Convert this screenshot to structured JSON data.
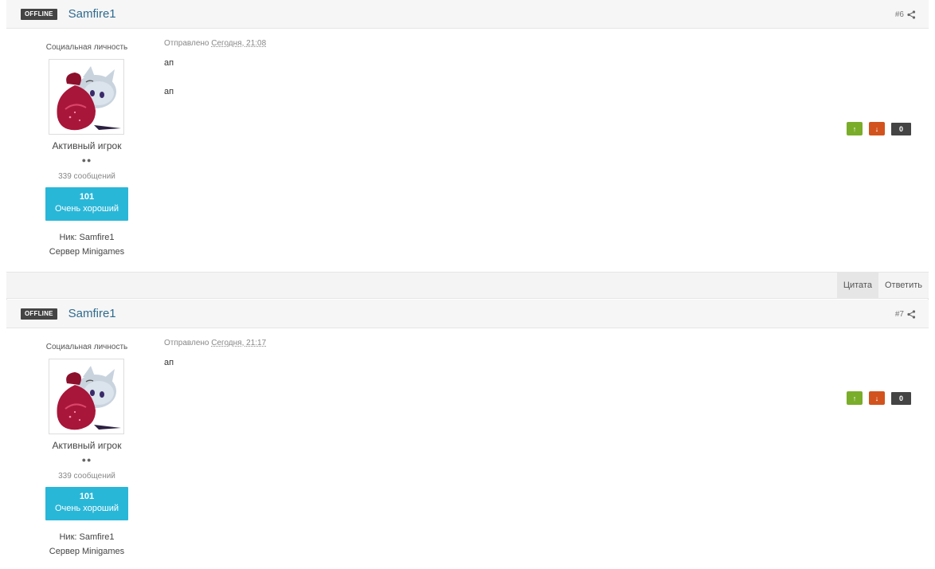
{
  "posts": [
    {
      "status": "OFFLINE",
      "author": "Samfire1",
      "post_number": "#6",
      "member_title": "Социальная личность",
      "rank": "Активный игрок",
      "pips": "●●",
      "post_count": "339 сообщений",
      "reputation": {
        "value": "101",
        "label": "Очень хороший"
      },
      "fields": [
        "Ник: Samfire1",
        "Сервер Minigames"
      ],
      "posted_prefix": "Отправлено",
      "posted_date": "Сегодня, 21:08",
      "content": [
        "ап",
        "ап"
      ],
      "rep_count": "0",
      "vote_up": "↑",
      "vote_down": "↓",
      "footer": {
        "quote": "Цитата",
        "reply": "Ответить"
      }
    },
    {
      "status": "OFFLINE",
      "author": "Samfire1",
      "post_number": "#7",
      "member_title": "Социальная личность",
      "rank": "Активный игрок",
      "pips": "●●",
      "post_count": "339 сообщений",
      "reputation": {
        "value": "101",
        "label": "Очень хороший"
      },
      "fields": [
        "Ник: Samfire1",
        "Сервер Minigames"
      ],
      "posted_prefix": "Отправлено",
      "posted_date": "Сегодня, 21:17",
      "content": [
        "ап"
      ],
      "rep_count": "0",
      "vote_up": "↑",
      "vote_down": "↓"
    }
  ],
  "colors": {
    "status_badge": "#444444",
    "author_link": "#2f6b8f",
    "reputation_box": "#29b7d8",
    "vote_up": "#7aad2a",
    "vote_down": "#d2531d"
  }
}
